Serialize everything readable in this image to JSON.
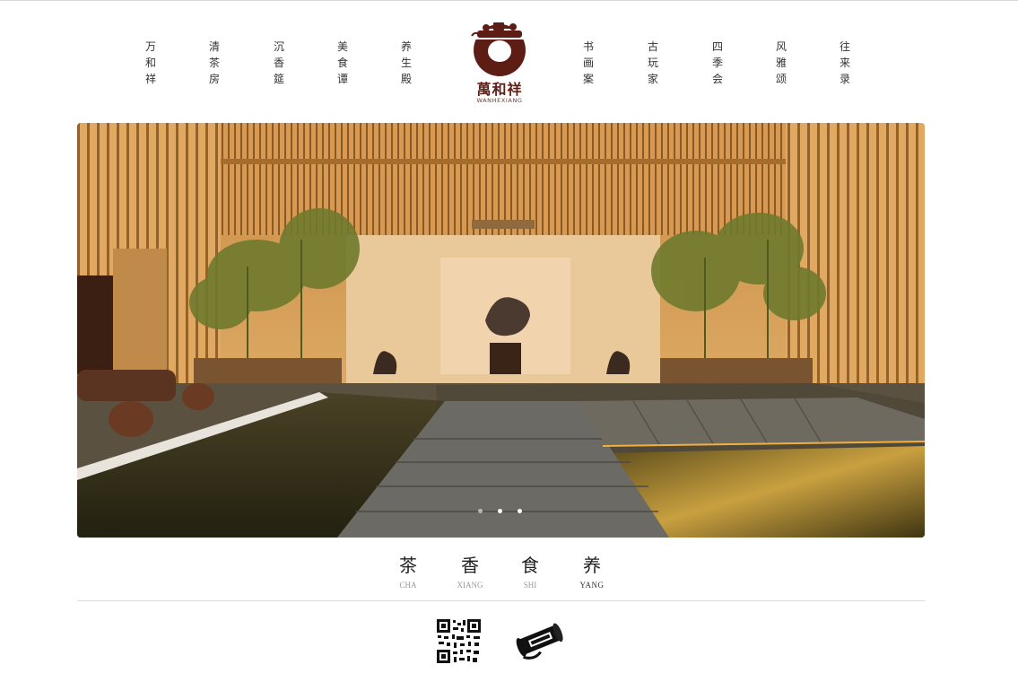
{
  "nav_left": [
    {
      "chars": [
        "万",
        "和",
        "祥"
      ]
    },
    {
      "chars": [
        "清",
        "茶",
        "房"
      ]
    },
    {
      "chars": [
        "沉",
        "香",
        "筵"
      ]
    },
    {
      "chars": [
        "美",
        "食",
        "谭"
      ]
    },
    {
      "chars": [
        "养",
        "生",
        "殿"
      ]
    }
  ],
  "nav_right": [
    {
      "chars": [
        "书",
        "画",
        "案"
      ]
    },
    {
      "chars": [
        "古",
        "玩",
        "家"
      ]
    },
    {
      "chars": [
        "四",
        "季",
        "会"
      ]
    },
    {
      "chars": [
        "风",
        "雅",
        "颂"
      ]
    },
    {
      "chars": [
        "往",
        "来",
        "录"
      ]
    }
  ],
  "logo": {
    "cn": "萬和祥",
    "en": "WANHEXIANG"
  },
  "carousel": {
    "slide_count": 3,
    "active": 1
  },
  "categories": [
    {
      "cn": "茶",
      "en": "CHA"
    },
    {
      "cn": "香",
      "en": "XIANG"
    },
    {
      "cn": "食",
      "en": "SHI"
    },
    {
      "cn": "养",
      "en": "YANG"
    }
  ],
  "colors": {
    "brand": "#5e1d14",
    "wood": "#d9a35e",
    "water": "#3a3420"
  },
  "icons": {
    "qr": "qr-code-icon",
    "weibo": "weibo-scroll-icon"
  }
}
